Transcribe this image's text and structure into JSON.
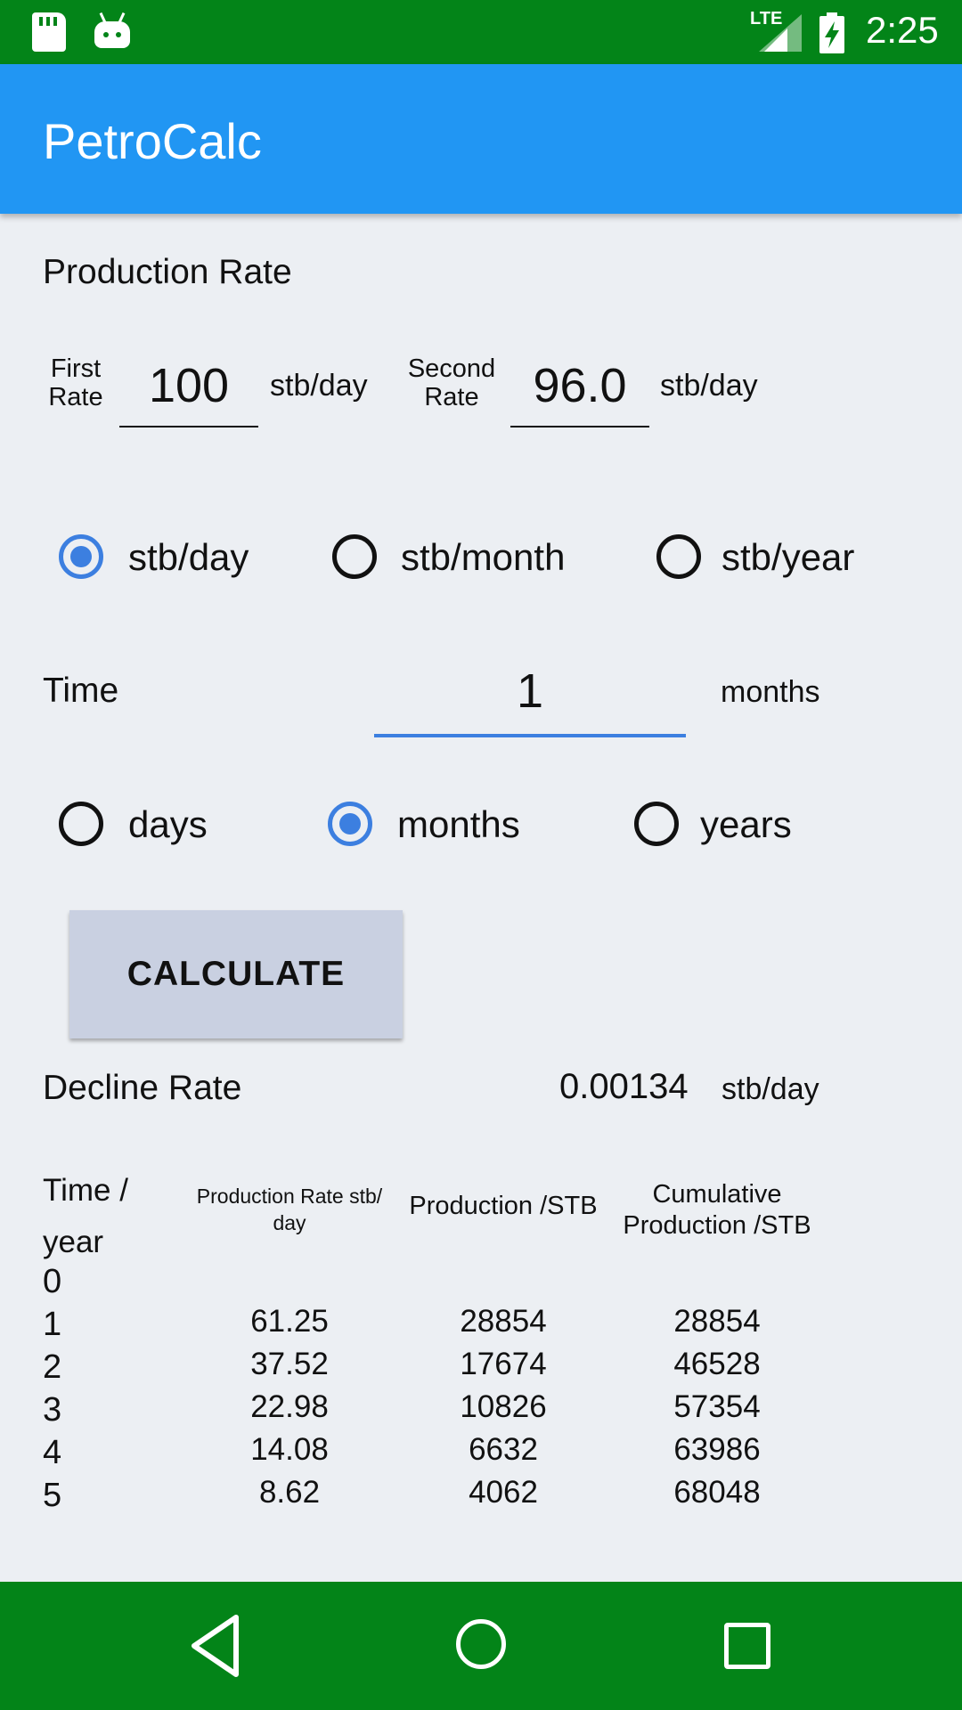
{
  "status_bar": {
    "time": "2:25",
    "network": "LTE"
  },
  "app_bar": {
    "title": "PetroCalc"
  },
  "production_rate": {
    "heading": "Production Rate",
    "first_rate_label_1": "First",
    "first_rate_label_2": "Rate",
    "first_rate_value": "100",
    "first_rate_unit": "stb/day",
    "second_rate_label_1": "Second",
    "second_rate_label_2": "Rate",
    "second_rate_value": "96.0",
    "second_rate_unit": "stb/day"
  },
  "rate_units": {
    "options": [
      "stb/day",
      "stb/month",
      "stb/year"
    ],
    "selected": "stb/day"
  },
  "time": {
    "label": "Time",
    "value": "1",
    "unit": "months"
  },
  "time_units": {
    "options": [
      "days",
      "months",
      "years"
    ],
    "selected": "months"
  },
  "calculate_button": "CALCULATE",
  "decline": {
    "label": "Decline Rate",
    "value": "0.00134",
    "unit": "stb/day"
  },
  "table": {
    "headers": {
      "time_1": "Time /",
      "time_2": "year",
      "rate_1": "Production Rate stb/",
      "rate_2": "day",
      "production": "Production /STB",
      "cumulative_1": "Cumulative",
      "cumulative_2": "Production /STB"
    },
    "rows": [
      {
        "time": "0",
        "rate": "",
        "production": "",
        "cumulative": ""
      },
      {
        "time": "1",
        "rate": "61.25",
        "production": "28854",
        "cumulative": "28854"
      },
      {
        "time": "2",
        "rate": "37.52",
        "production": "17674",
        "cumulative": "46528"
      },
      {
        "time": "3",
        "rate": "22.98",
        "production": "10826",
        "cumulative": "57354"
      },
      {
        "time": "4",
        "rate": "14.08",
        "production": "6632",
        "cumulative": "63986"
      },
      {
        "time": "5",
        "rate": "8.62",
        "production": "4062",
        "cumulative": "68048"
      }
    ]
  },
  "colors": {
    "status_bar": "#038418",
    "app_bar": "#2196F3",
    "accent": "#3C7FE0",
    "background": "#ECEFF3",
    "button": "#C9D0E1"
  }
}
